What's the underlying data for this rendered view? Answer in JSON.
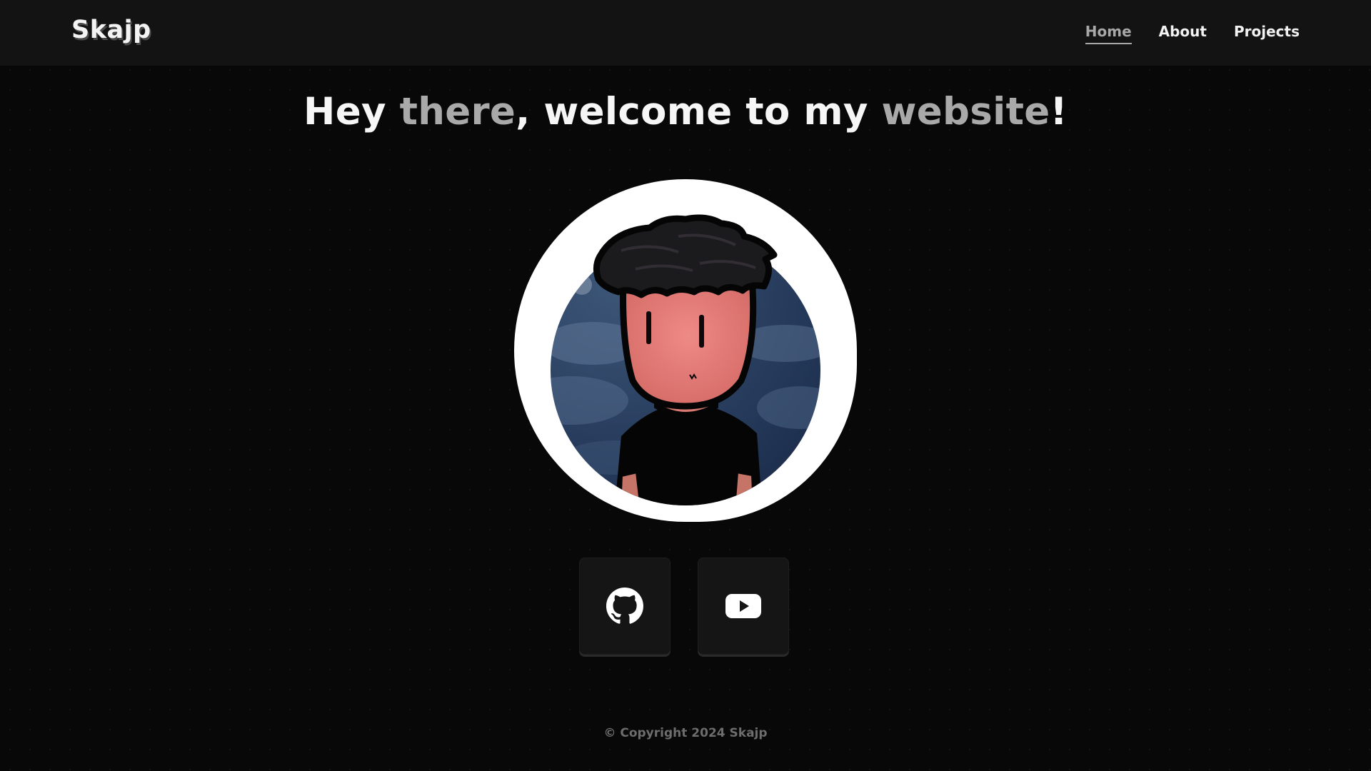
{
  "nav": {
    "brand": "Skajp",
    "links": [
      {
        "label": "Home",
        "active": true
      },
      {
        "label": "About",
        "active": false
      },
      {
        "label": "Projects",
        "active": false
      }
    ]
  },
  "hero": {
    "headline_parts": [
      "Hey ",
      "there",
      ", welcome to my ",
      "website",
      "!"
    ]
  },
  "avatar": {
    "icon": "cartoon-avatar-portrait"
  },
  "social": [
    {
      "icon": "github-icon"
    },
    {
      "icon": "youtube-icon"
    }
  ],
  "footer": {
    "copyright": "© Copyright 2024 Skajp"
  },
  "colors": {
    "background": "#080808",
    "navbar": "#131313",
    "accent_text": "#a9a9a9",
    "text": "#f6f6f6",
    "footer_text": "#6d6d6d"
  }
}
